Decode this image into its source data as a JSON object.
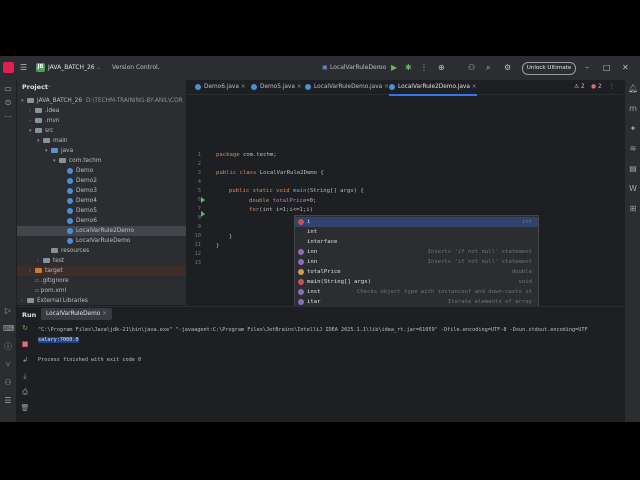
{
  "titlebar": {
    "project_badge": "JB",
    "project_name": "JAVA_BATCH_26",
    "vcs": "Version Control",
    "run_config": "LocalVarRuleDemo",
    "unlock_button": "Unlock Ultimate"
  },
  "project": {
    "title": "Project",
    "tree": [
      {
        "label": "JAVA_BATCH_26",
        "path": "D:\\TECHM-TRAINING-BY-ANIL\\COR",
        "indent": 0,
        "kind": "fold",
        "arrow": "▾"
      },
      {
        "label": ".idea",
        "indent": 1,
        "kind": "fold",
        "arrow": "›"
      },
      {
        "label": ".mvn",
        "indent": 1,
        "kind": "fold",
        "arrow": "›"
      },
      {
        "label": "src",
        "indent": 1,
        "kind": "fold",
        "arrow": "▾"
      },
      {
        "label": "main",
        "indent": 2,
        "kind": "fold",
        "arrow": "▾"
      },
      {
        "label": "java",
        "indent": 3,
        "kind": "fold blue",
        "arrow": "▾"
      },
      {
        "label": "com.techm",
        "indent": 4,
        "kind": "fold",
        "arrow": "▾"
      },
      {
        "label": "Demo",
        "indent": 5,
        "kind": "cls",
        "arrow": ""
      },
      {
        "label": "Demo2",
        "indent": 5,
        "kind": "cls",
        "arrow": ""
      },
      {
        "label": "Demo3",
        "indent": 5,
        "kind": "cls",
        "arrow": ""
      },
      {
        "label": "Demo4",
        "indent": 5,
        "kind": "cls",
        "arrow": ""
      },
      {
        "label": "Demo5",
        "indent": 5,
        "kind": "cls",
        "arrow": ""
      },
      {
        "label": "Demo6",
        "indent": 5,
        "kind": "cls",
        "arrow": ""
      },
      {
        "label": "LocalVarRule2Demo",
        "indent": 5,
        "kind": "cls",
        "arrow": "",
        "selected": true
      },
      {
        "label": "LocalVarRuleDemo",
        "indent": 5,
        "kind": "cls",
        "arrow": ""
      },
      {
        "label": "resources",
        "indent": 3,
        "kind": "fold",
        "arrow": ""
      },
      {
        "label": "test",
        "indent": 2,
        "kind": "fold",
        "arrow": "›"
      },
      {
        "label": "target",
        "indent": 1,
        "kind": "fold orange",
        "arrow": "›",
        "target": true
      },
      {
        "label": ".gitignore",
        "indent": 1,
        "kind": "file",
        "arrow": ""
      },
      {
        "label": "pom.xml",
        "indent": 1,
        "kind": "file",
        "arrow": ""
      },
      {
        "label": "External Libraries",
        "indent": 0,
        "kind": "fold",
        "arrow": "›"
      }
    ]
  },
  "editor": {
    "tabs": [
      "Demo6.java",
      "Demo5.java",
      "LocalVarRuleDemo.java",
      "LocalVarRule2Demo.java"
    ],
    "inspection_warn": "2",
    "inspection_err": "2",
    "line_numbers": [
      "1",
      "2",
      "3",
      "4",
      "5",
      "6",
      "7",
      "8",
      "9",
      "10",
      "11",
      "12",
      "13"
    ],
    "code": {
      "l1_kw": "package",
      "l1_rest": " com.techm;",
      "l3_kw": "public class",
      "l3_name": " LocalVarRule2Demo",
      "l3_rest": " {",
      "l5_kw": "public static void",
      "l5_fn": " main",
      "l5_rest": "(String[] args) {",
      "l6_kw": "double",
      "l6_var": " totalPrice",
      "l6_rest": "=0;",
      "l7_kw": "for",
      "l7_rest": "(int i=1;i<=1;i)",
      "l9": "}",
      "l10": "}"
    }
  },
  "completion": {
    "items": [
      {
        "name": "i",
        "right": "int",
        "icon": "#c75450",
        "selected": true
      },
      {
        "name": "int",
        "right": "",
        "icon": ""
      },
      {
        "name": "interface",
        "right": "",
        "icon": ""
      },
      {
        "name": "inn",
        "right": "Inserts 'if not null' statement",
        "icon": "#8a6fb8"
      },
      {
        "name": "inn",
        "right": "Inserts 'if not null' statement",
        "icon": "#8a6fb8"
      },
      {
        "name": "totalPrice",
        "right": "double",
        "icon": "#d49a4d"
      },
      {
        "name": "main(String[] args)",
        "right": "void",
        "icon": "#c75450"
      },
      {
        "name": "inst",
        "right": "Checks object type with instanceof and down-casts it",
        "icon": "#8a6fb8"
      },
      {
        "name": "itar",
        "right": "Iterate elements of array",
        "icon": "#8a6fb8"
      },
      {
        "name": "itco",
        "right": "Iterate elements of java.util.Collection",
        "icon": "#8a6fb8"
      },
      {
        "name": "iten",
        "right": "Iterate java.util.Enumeration",
        "icon": "#8a6fb8"
      },
      {
        "name": "iter",
        "right": "Iterate Iterable or array",
        "icon": "#8a6fb8"
      }
    ],
    "footer": "Press Ctrl+. to choose the selected (or first) suggestion and insert a dot afterwards",
    "next_tip": "Next Tip"
  },
  "run": {
    "title": "Run",
    "tab": "LocalVarRuleDemo",
    "cmd": "\"C:\\Program Files\\Java\\jdk-21\\bin\\java.exe\" \"-javaagent:C:\\Program Files\\JetBrains\\IntelliJ IDEA 2025.1.1\\lib\\idea_rt.jar=61059\" -Dfile.encoding=UTF-8 -Dsun.stdout.encoding=UTF",
    "result": "salary:7000.0",
    "exit": "Process finished with exit code 0"
  }
}
